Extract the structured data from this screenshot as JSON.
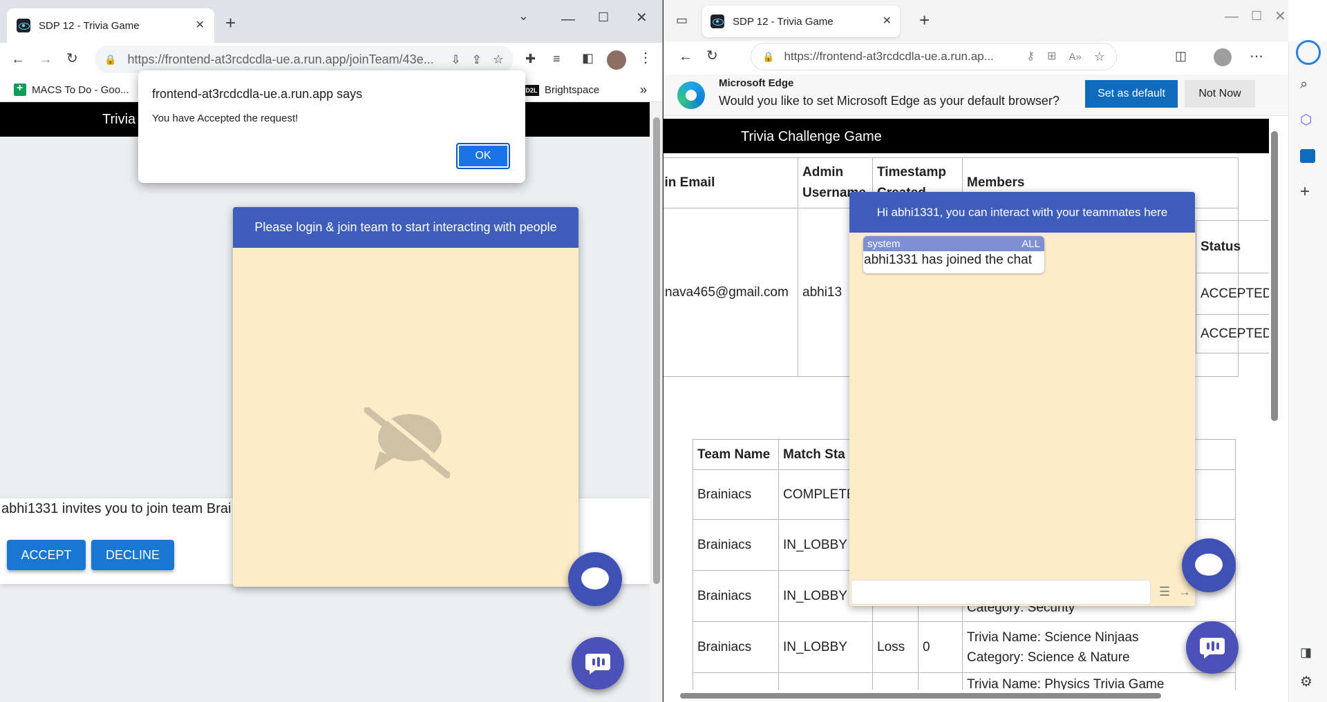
{
  "left_window": {
    "tab_title": "SDP 12 - Trivia Game",
    "url": "https://frontend-at3rcdcdla-ue.a.run.app/joinTeam/43e...",
    "bookmarks": [
      "MACS To Do - Goo...",
      "Brightspace"
    ],
    "bookmarks_more": "»",
    "navbar_brand": "Trivia",
    "alert": {
      "title": "frontend-at3rcdcdla-ue.a.run.app says",
      "message": "You have Accepted the request!",
      "ok_label": "OK"
    },
    "invite": {
      "message": "abhi1331 invites you to join team Brai",
      "accept_label": "ACCEPT",
      "decline_label": "DECLINE"
    },
    "chat_panel": {
      "header": "Please login & join team to start interacting with people",
      "empty_icon": "chat-disabled-icon"
    }
  },
  "right_window": {
    "tab_title": "SDP 12 - Trivia Game",
    "url": "https://frontend-at3rcdcdla-ue.a.run.ap...",
    "banner": {
      "title": "Microsoft Edge",
      "message": "Would you like to set Microsoft Edge as your default browser?",
      "set_default_label": "Set as default",
      "not_now_label": "Not Now"
    },
    "navbar_brand": "Trivia Challenge Game",
    "admin_table": {
      "headers": [
        "in Email",
        "Admin Username",
        "Timestamp Created",
        "Members"
      ],
      "row": {
        "email": "nava465@gmail.com",
        "username": "abhi13"
      },
      "members_subtable": {
        "header": "Status",
        "values": [
          "ACCEPTED",
          "ACCEPTED"
        ]
      }
    },
    "matches_table": {
      "headers": [
        "Team Name",
        "Match Sta"
      ],
      "rows": [
        {
          "team": "Brainiacs",
          "status": "COMPLETE",
          "result": "",
          "score": "",
          "details": []
        },
        {
          "team": "Brainiacs",
          "status": "IN_LOBBY",
          "result": "",
          "score": "",
          "details": []
        },
        {
          "team": "Brainiacs",
          "status": "IN_LOBBY",
          "result": "",
          "score": "",
          "details": [
            "Category: Security"
          ]
        },
        {
          "team": "Brainiacs",
          "status": "IN_LOBBY",
          "result": "Loss",
          "score": "0",
          "details": [
            "Trivia Name: Science Ninjaas",
            "Category: Science & Nature"
          ]
        },
        {
          "team": "",
          "status": "",
          "result": "",
          "score": "",
          "details": [
            "Trivia Name: Physics Trivia Game"
          ]
        }
      ]
    },
    "chat_panel": {
      "header": "Hi abhi1331, you can interact with your teammates here",
      "message": {
        "sender": "system",
        "scope": "ALL",
        "text": "abhi1331 has joined the chat"
      },
      "input_placeholder": ""
    }
  },
  "colors": {
    "chat_header": "#3f5dba",
    "chat_body": "#fdecc8",
    "button_blue": "#1976d2",
    "fab": "#3f51b5"
  }
}
